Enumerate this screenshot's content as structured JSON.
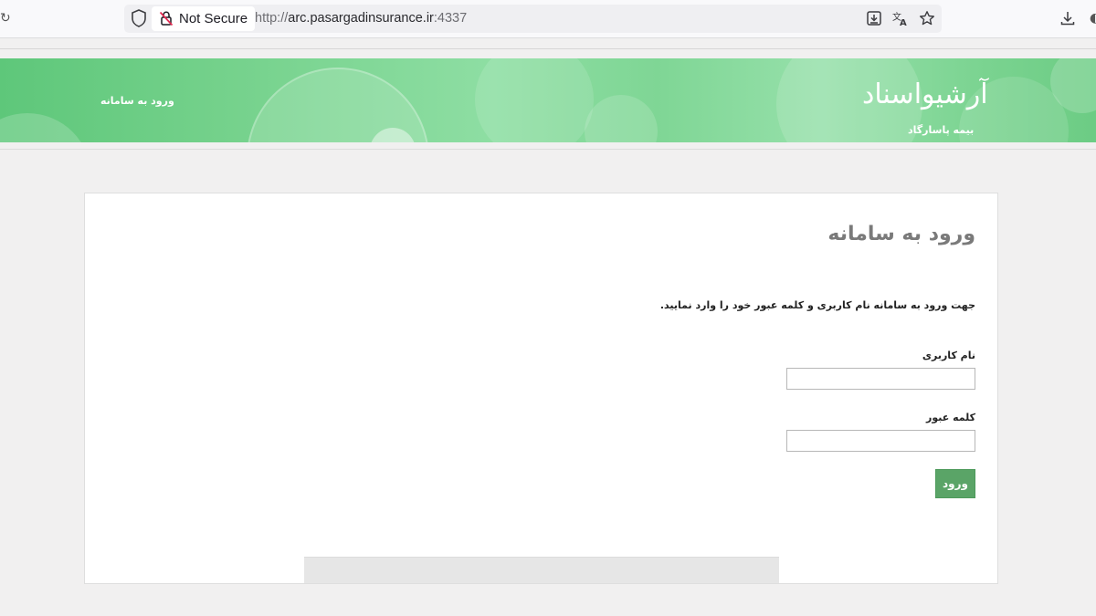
{
  "browser": {
    "security_label": "Not Secure",
    "url_scheme": "http://",
    "url_host": "arc.pasargadinsurance.ir",
    "url_port": ":4337",
    "icons": [
      "shield-icon",
      "lock-slash-icon",
      "save-page-icon",
      "translate-icon",
      "star-icon",
      "download-icon"
    ]
  },
  "header": {
    "login_link": "ورود به سامانه",
    "logo_title": "آرشیواسناد",
    "logo_subtitle": "بیمه پاسارگاد"
  },
  "login": {
    "title": "ورود به سامانه",
    "instructions": "جهت ورود به سامانه نام کاربری و کلمه عبور خود را وارد نمایید.",
    "username_label": "نام کاربری",
    "username_value": "",
    "password_label": "کلمه عبور",
    "password_value": "",
    "submit_label": "ورود"
  },
  "colors": {
    "banner_green": "#74d18b",
    "button_green": "#5aa467",
    "title_gray": "#7a7a7a"
  }
}
